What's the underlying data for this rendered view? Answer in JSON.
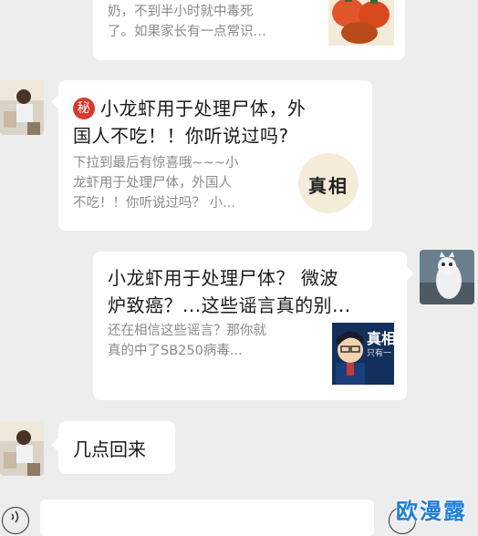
{
  "messages": [
    {
      "desc_lines": [
        "奶，不到半小时就中毒死",
        "了。如果家长有一点常识…"
      ]
    },
    {
      "seal_char": "秘",
      "title_lines": [
        "小龙虾用于处理尸体，外",
        "国人不吃！！你听说过吗?"
      ],
      "desc_lines": [
        "下拉到最后有惊喜哦~~~小",
        "龙虾用于处理尸体，外国人",
        "不吃！！你听说过吗？ 小..."
      ],
      "thumb_text": "真相"
    },
    {
      "title_lines": [
        "小龙虾用于处理尸体？ 微波",
        "炉致癌？...这些谣言真的别..."
      ],
      "desc_lines": [
        "还在相信这些谣言？那你就",
        "真的中了SB250病毒..."
      ],
      "thumb_text": "真相",
      "thumb_subtext": "只有一"
    },
    {
      "text": "几点回来"
    }
  ],
  "watermark": "欧漫露",
  "colors": {
    "background": "#ededed",
    "bubble": "#ffffff",
    "secondary_text": "#8a8a8a",
    "seal": "#d63a2f",
    "watermark": "#1f7fd6"
  },
  "icons": [
    "voice-icon",
    "emoji-icon"
  ]
}
